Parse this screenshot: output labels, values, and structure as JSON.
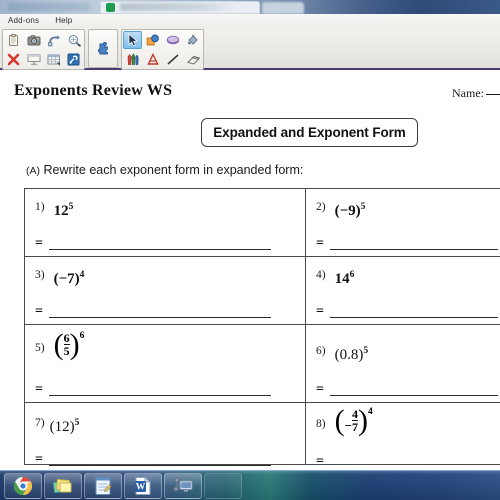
{
  "browser": {
    "tab_favicon": "green-square-favicon",
    "tab_title_blurred": "",
    "url_bar_blurred": ""
  },
  "app": {
    "menubar": {
      "items": [
        {
          "label": "Add-ons",
          "name": "menu-add-ons"
        },
        {
          "label": "Help",
          "name": "menu-help"
        }
      ]
    },
    "toolbar": {
      "groups": [
        {
          "name": "clipboard-group",
          "rows": [
            [
              {
                "icon": "paste-clipboard-icon",
                "active": false
              },
              {
                "icon": "screen-capture-camera-icon",
                "active": false
              },
              {
                "icon": "undo-arrow-icon",
                "active": false
              },
              {
                "icon": "magnifier-zoom-icon",
                "active": false
              }
            ],
            [
              {
                "icon": "delete-red-x-icon",
                "active": false
              },
              {
                "icon": "screen-shade-icon",
                "active": false
              },
              {
                "icon": "insert-table-icon",
                "active": false
              },
              {
                "icon": "blue-tools-icon",
                "active": false
              }
            ]
          ]
        },
        {
          "name": "add-ons-group",
          "rows": [
            [
              {
                "icon": "puzzle-piece-icon",
                "active": false
              }
            ]
          ]
        },
        {
          "name": "ink-tools-group",
          "rows": [
            [
              {
                "icon": "select-arrow-icon",
                "active": true
              },
              {
                "icon": "shapes-icon",
                "active": false
              },
              {
                "icon": "highlighter-icon",
                "active": false
              },
              {
                "icon": "ink-fill-bucket-icon",
                "active": false
              }
            ],
            [
              {
                "icon": "pens-markers-icon",
                "active": false
              },
              {
                "icon": "text-tool-a-icon",
                "active": false
              },
              {
                "icon": "line-tool-icon",
                "active": false
              },
              {
                "icon": "eraser-icon",
                "active": false
              }
            ]
          ]
        }
      ]
    },
    "accent_color": "#4b3b72",
    "active_tool_color": "#7fc0ea"
  },
  "document": {
    "title": "Exponents Review WS",
    "name_label": "Name:",
    "section_banner": "Expanded and Exponent Form",
    "instruction_lead": "(A)",
    "instruction_text": "Rewrite each exponent form in expanded form:",
    "equals_sign": "=",
    "problems": [
      {
        "num": "1)",
        "expr_type": "power",
        "base": "12",
        "exponent": "5",
        "display": "12⁵"
      },
      {
        "num": "2)",
        "expr_type": "power",
        "base": "(−9)",
        "exponent": "5",
        "display": "(−9)⁵"
      },
      {
        "num": "3)",
        "expr_type": "power",
        "base": "(−7)",
        "exponent": "4",
        "display": "(−7)⁴"
      },
      {
        "num": "4)",
        "expr_type": "power",
        "base": "14",
        "exponent": "6",
        "display": "14⁶"
      },
      {
        "num": "5)",
        "expr_type": "fraction-power",
        "numerator": "6",
        "denominator": "5",
        "negative": false,
        "exponent": "6",
        "display": "(6/5)⁶"
      },
      {
        "num": "6)",
        "expr_type": "power",
        "base": "(0.8)",
        "exponent": "5",
        "display": "(0.8)⁵"
      },
      {
        "num": "7)",
        "expr_type": "power",
        "base": "(12)",
        "exponent": "5",
        "display": "(12)⁵"
      },
      {
        "num": "8)",
        "expr_type": "fraction-power",
        "numerator": "4",
        "denominator": "7",
        "negative": true,
        "exponent": "4",
        "display": "(−4/7)⁴"
      }
    ]
  },
  "taskbar": {
    "buttons": [
      {
        "name": "taskbar-chrome",
        "icon": "google-chrome-icon"
      },
      {
        "name": "taskbar-sticky-notes",
        "icon": "sticky-notes-icon"
      },
      {
        "name": "taskbar-journal",
        "icon": "notepad-journal-icon"
      },
      {
        "name": "taskbar-word",
        "icon": "microsoft-word-icon"
      },
      {
        "name": "taskbar-remote-desktop",
        "icon": "remote-desktop-icon"
      }
    ]
  }
}
